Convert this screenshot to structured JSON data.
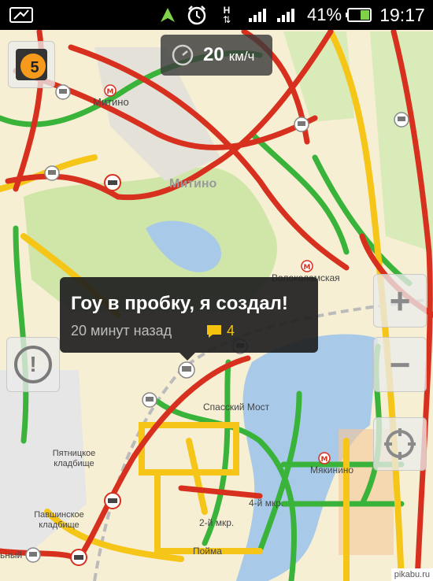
{
  "status_bar": {
    "battery_percent": "41%",
    "time": "19:17",
    "network_label": "H"
  },
  "speed_widget": {
    "value": "20",
    "unit": "км/ч"
  },
  "tooltip": {
    "title": "Гоу в пробку, я создал!",
    "time_ago": "20 минут назад",
    "comment_count": "4"
  },
  "traffic_score_badge": "5",
  "map_labels": {
    "mitino_station": "Митино",
    "mitino_district": "Митино",
    "volokolamskaya": "Волоколамская",
    "spassky_most": "Спасский Мост",
    "myakinino": "Мякинино",
    "mkr4": "4-й мкр.",
    "mkr2": "2-й мкр.",
    "pyatnitskoe": "Пятницкое кладбище",
    "pavshinskoe": "Павшинское кладбище",
    "poyma": "Пойма",
    "edge_label": "ьный"
  },
  "controls": {
    "zoom_in": "+",
    "zoom_out": "−",
    "alert": "!"
  },
  "watermark": "pikabu.ru",
  "colors": {
    "traffic_red": "#d7301f",
    "traffic_yellow": "#f5c518",
    "traffic_green": "#3ab33a",
    "park_green": "#cfe6a8",
    "water_blue": "#a9c9e8"
  }
}
